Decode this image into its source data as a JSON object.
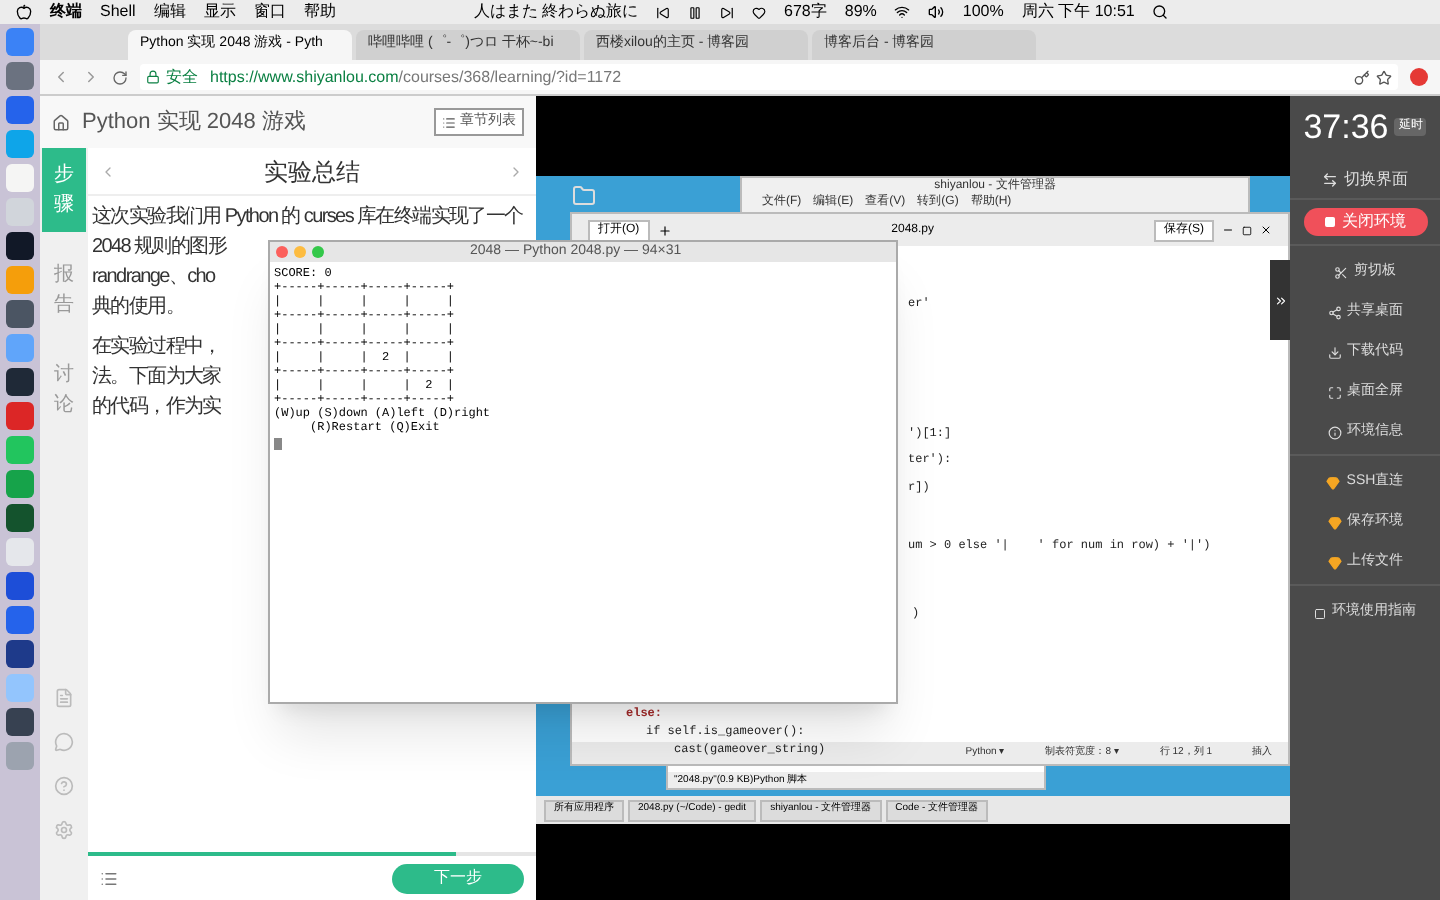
{
  "menubar": {
    "app_menu": [
      "终端",
      "Shell",
      "编辑",
      "显示",
      "窗口",
      "帮助"
    ],
    "now_playing": "人はまた 終わらぬ旅に",
    "status": [
      "678字",
      "89%",
      "100%"
    ],
    "clock": "周六 下午 10:51"
  },
  "browser": {
    "tabs": [
      {
        "title": "Python 实现 2048 游戏 - Pyth",
        "selected": true
      },
      {
        "title": "哔哩哔哩 (゜-゜)つロ 干杯~-bi",
        "selected": false
      },
      {
        "title": "西楼xilou的主页 - 博客园",
        "selected": false
      },
      {
        "title": "博客后台 - 博客园",
        "selected": false
      }
    ],
    "address": {
      "secure_label": "安全",
      "url_host": "https://www.shiyanlou.com",
      "url_path": "/courses/368/learning/?id=1172"
    }
  },
  "course": {
    "title": "Python 实现 2048 游戏",
    "chapter_button": "章节列表",
    "nav": [
      {
        "label": "步骤",
        "selected": true
      },
      {
        "label": "报告",
        "selected": false
      },
      {
        "label": "讨论",
        "selected": false
      }
    ],
    "step_title": "实验总结",
    "paragraphs": [
      [
        "这次实验我们用 Python 的 curses 库在终端实现了一个",
        "2048 规则的图形",
        "randrange、cho",
        "典的使用。"
      ],
      [
        "在实验过程中，",
        "法。下面为大家",
        "的代码，作为实"
      ]
    ],
    "progress": {
      "level": 0.82
    },
    "next_button": "下一步"
  },
  "terminal": {
    "title": "2048 — Python 2048.py — 94×31",
    "lines": [
      "SCORE: 0",
      "+-----+-----+-----+-----+",
      "|     |     |     |     |",
      "+-----+-----+-----+-----+",
      "|     |     |     |     |",
      "+-----+-----+-----+-----+",
      "|     |     |  2  |     |",
      "+-----+-----+-----+-----+",
      "|     |     |     |  2  |",
      "+-----+-----+-----+-----+",
      "(W)up (S)down (A)left (D)right",
      "     (R)Restart (Q)Exit"
    ]
  },
  "remote_desktop": {
    "file_manager": {
      "title": "shiyanlou - 文件管理器",
      "menu": [
        "文件(F)",
        "编辑(E)",
        "查看(V)",
        "转到(G)",
        "帮助(H)"
      ]
    },
    "editor": {
      "open_button": "打开(O)",
      "title": "2048.py",
      "save_button": "保存(S)",
      "code_fragments": [
        "er'",
        "')[1:]",
        "ter'):",
        "r])",
        "um > 0 else '|    ' for num in row) + '|')",
        ")",
        "else:",
        "if self.is_gameover():",
        "cast(gameover_string)"
      ],
      "status": [
        "Python ▾",
        "制表符宽度：8 ▾",
        "行 12，列 1",
        "插入"
      ]
    },
    "file_status": "\"2048.py\"(0.9 KB)Python 脚本",
    "taskbar": [
      "所有应用程序",
      "2048.py (~/Code) - gedit",
      "shiyanlou - 文件管理器",
      "Code - 文件管理器"
    ]
  },
  "lab_sidebar": {
    "timer": "37:36",
    "extend_button": "延时",
    "items": [
      {
        "kind": "link",
        "label": "切换界面"
      },
      {
        "kind": "danger",
        "label": "关闭环境"
      },
      {
        "kind": "tool",
        "label": "剪切板"
      },
      {
        "kind": "tool",
        "label": "共享桌面"
      },
      {
        "kind": "tool",
        "label": "下载代码"
      },
      {
        "kind": "tool",
        "label": "桌面全屏"
      },
      {
        "kind": "tool",
        "label": "环境信息"
      },
      {
        "kind": "premium",
        "label": "SSH直连"
      },
      {
        "kind": "premium",
        "label": "保存环境"
      },
      {
        "kind": "premium",
        "label": "上传文件"
      },
      {
        "kind": "guide",
        "label": "环境使用指南"
      }
    ]
  }
}
